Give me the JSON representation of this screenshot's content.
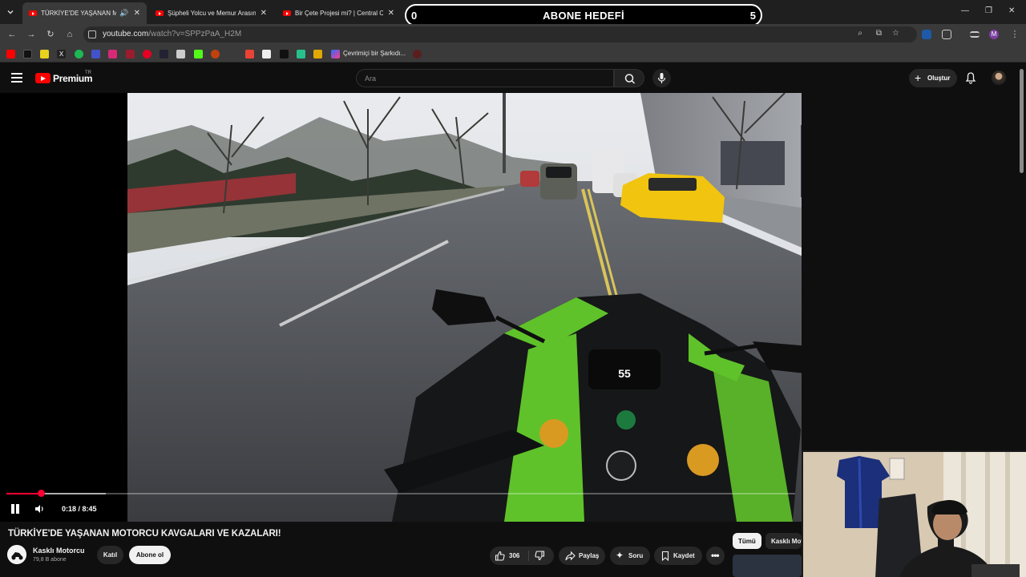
{
  "browser": {
    "tabs": [
      {
        "title": "TÜRKİYE'DE YAŞANAN MOTORCU KAVGALARI",
        "active": true,
        "audio": true
      },
      {
        "title": "Şüpheli Yolcu ve Memur Arasında",
        "active": false
      },
      {
        "title": "Bir Çete Projesi mi? | Central Cee",
        "active": false
      }
    ],
    "url_host": "youtube.com",
    "url_path": "/watch?v=SPPzPaA_H2M",
    "bookmark_label": "Çevrimiçi bir Şarkıdı...",
    "profile_initial": "M"
  },
  "overlay": {
    "left_value": "0",
    "title": "ABONE HEDEFİ",
    "right_value": "5"
  },
  "youtube": {
    "logo_text": "Premium",
    "region": "TR",
    "search_placeholder": "Ara",
    "create_label": "Oluştur"
  },
  "player": {
    "current_time": "0:18",
    "duration": "8:45",
    "time_display": "0:18 / 8:45",
    "progress_fraction": 0.044,
    "buffered_fraction": 0.126,
    "speed_readout": "55"
  },
  "video": {
    "title": "TÜRKİYE'DE YAŞANAN MOTORCU KAVGALARI VE KAZALARI!",
    "channel_name": "Kasklı Motorcu",
    "subscribers": "79,8 B abone",
    "join_label": "Katıl",
    "subscribe_label": "Abone ol",
    "likes": "306",
    "share_label": "Paylaş",
    "ask_label": "Soru",
    "save_label": "Kaydet"
  },
  "side": {
    "chips": [
      "Tümü",
      "Kasklı Mot"
    ]
  },
  "colors": {
    "accent": "#ff0033",
    "background": "#0f0f0f",
    "surface": "#272727",
    "bike_green": "#5fc22a",
    "taxi_yellow": "#f1c40f"
  }
}
